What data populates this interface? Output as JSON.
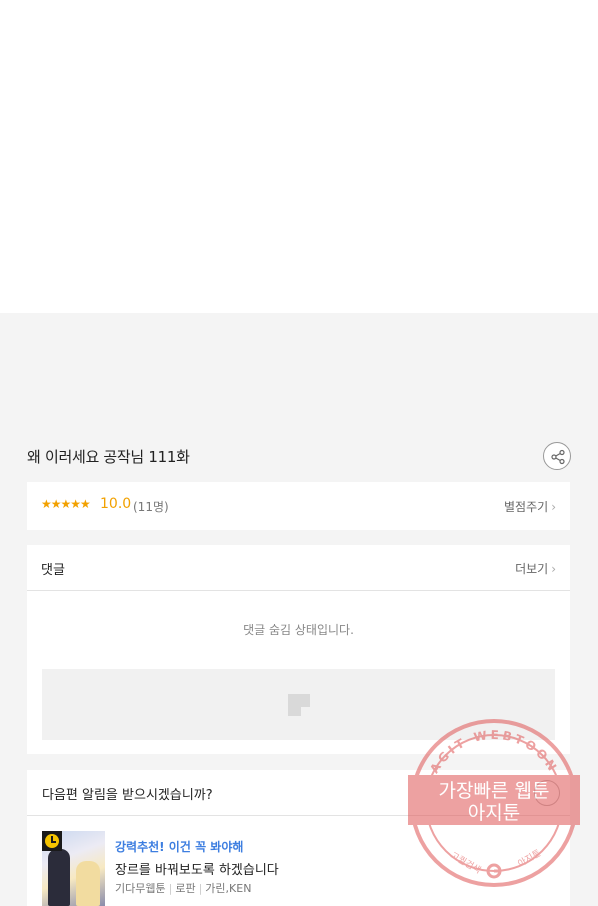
{
  "episode": {
    "title": "왜 이러세요 공작님 111화"
  },
  "rating": {
    "stars": "★★★★★",
    "score": "10.0",
    "count": "(11명)",
    "rate_link": "별점주기"
  },
  "comments": {
    "title": "댓글",
    "more_link": "더보기",
    "hidden_message": "댓글 숨김 상태입니다."
  },
  "notify": {
    "title": "다음편 알림을 받으시겠습니까?"
  },
  "recommend": {
    "tag": "강력추천! 이건 꼭 봐야해",
    "title": "장르를 바꿔보도록 하겠습니다",
    "meta": [
      "기다무웹툰",
      "로판",
      "가린,KEN"
    ]
  },
  "watermark": {
    "ring_text": "AGIT WEBTOON",
    "line1": "가장빠른 웹툰",
    "line2": "아지툰",
    "bottom_left": "고퀄검색",
    "bottom_right": "아지툰",
    "color": "#e05555"
  },
  "colors": {
    "accent_star": "#f2a100",
    "link_blue": "#3d7ee0"
  }
}
